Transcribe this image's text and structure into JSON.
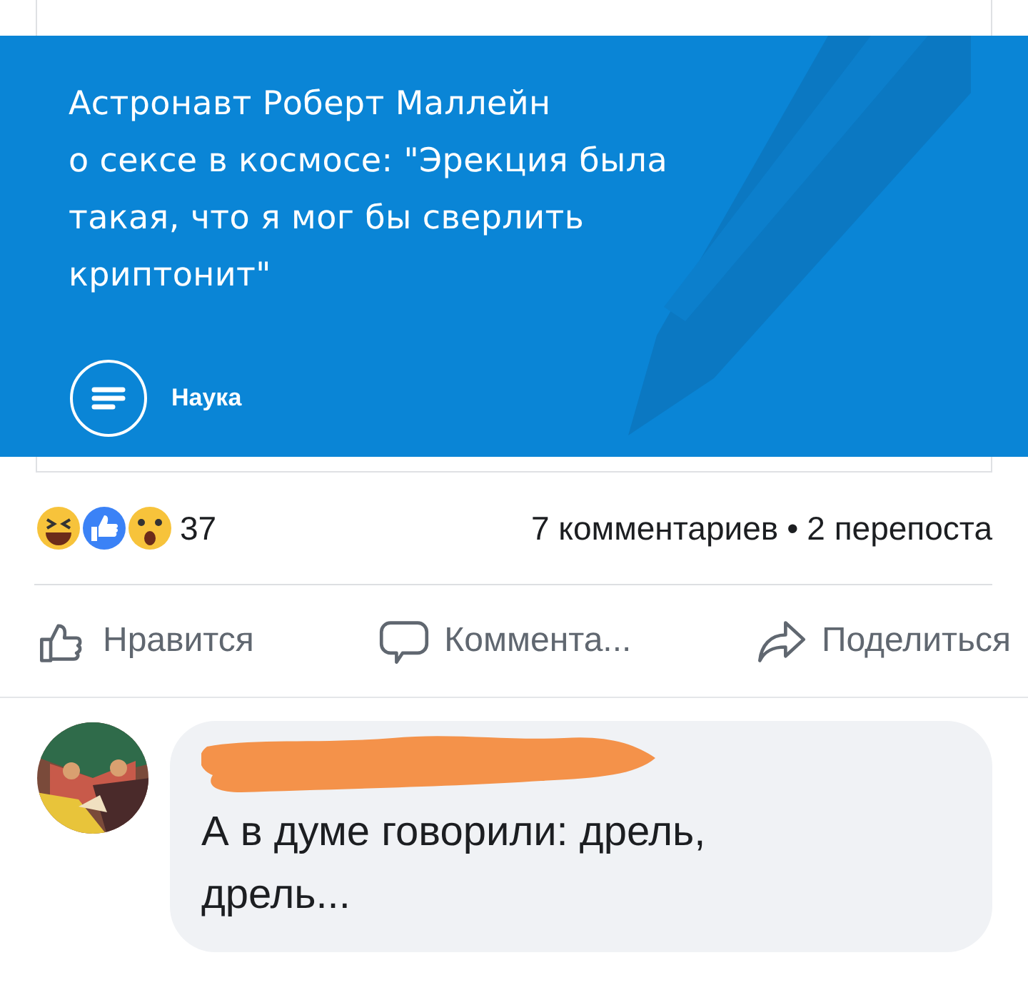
{
  "link_card": {
    "title_lines": [
      "Астронавт Роберт Маллейн",
      "о сексе в космосе: \"Эрекция была",
      "такая, что я мог бы сверлить",
      "криптонит\""
    ],
    "category": "Наука"
  },
  "stats": {
    "reaction_count": "37",
    "comments": "7 комментариев",
    "separator": "•",
    "shares": "2 перепоста"
  },
  "actions": [
    {
      "kind": "like",
      "label": "Нравится"
    },
    {
      "kind": "comment",
      "label": "Коммента..."
    },
    {
      "kind": "share",
      "label": "Поделиться"
    }
  ],
  "comments": [
    {
      "author_redacted": true,
      "text": "А в думе говорили: дрель, дрель..."
    }
  ]
}
